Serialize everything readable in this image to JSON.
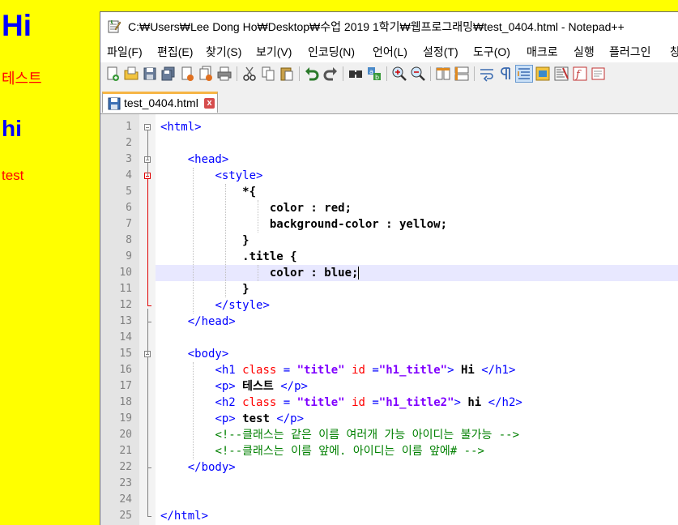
{
  "rendered_page": {
    "h1": "Hi",
    "p1": "테스트",
    "h2": "hi",
    "p2": "test"
  },
  "window": {
    "title": "C:₩Users₩Lee Dong Ho₩Desktop₩수업 2019 1학기₩웹프로그래밍₩test_0404.html - Notepad++",
    "menu": [
      "파일(F)",
      "편집(E)",
      "찾기(S)",
      "보기(V)",
      "인코딩(N)",
      "언어(L)",
      "설정(T)",
      "도구(O)",
      "매크로",
      "실행",
      "플러그인",
      "창"
    ],
    "tab": {
      "label": "test_0404.html",
      "close": "x"
    }
  },
  "editor": {
    "lines": [
      {
        "n": "1",
        "segs": [
          [
            "tag",
            "<html>"
          ]
        ]
      },
      {
        "n": "2",
        "segs": []
      },
      {
        "n": "3",
        "segs": [
          [
            "txt",
            "    "
          ],
          [
            "tag",
            "<head>"
          ]
        ]
      },
      {
        "n": "4",
        "segs": [
          [
            "txt",
            "        "
          ],
          [
            "tag",
            "<style>"
          ]
        ]
      },
      {
        "n": "5",
        "segs": [
          [
            "sel",
            "            *{"
          ]
        ]
      },
      {
        "n": "6",
        "segs": [
          [
            "sel",
            "                color : red;"
          ]
        ]
      },
      {
        "n": "7",
        "segs": [
          [
            "sel",
            "                background-color : yellow;"
          ]
        ]
      },
      {
        "n": "8",
        "segs": [
          [
            "sel",
            "            }"
          ]
        ]
      },
      {
        "n": "9",
        "segs": [
          [
            "sel",
            "            .title {"
          ]
        ]
      },
      {
        "n": "10",
        "segs": [
          [
            "sel",
            "                color : blue;"
          ]
        ]
      },
      {
        "n": "11",
        "segs": [
          [
            "sel",
            "            }"
          ]
        ]
      },
      {
        "n": "12",
        "segs": [
          [
            "txt",
            "        "
          ],
          [
            "tag",
            "</style>"
          ]
        ]
      },
      {
        "n": "13",
        "segs": [
          [
            "txt",
            "    "
          ],
          [
            "tag",
            "</head>"
          ]
        ]
      },
      {
        "n": "14",
        "segs": []
      },
      {
        "n": "15",
        "segs": [
          [
            "txt",
            "    "
          ],
          [
            "tag",
            "<body>"
          ]
        ]
      },
      {
        "n": "16",
        "segs": [
          [
            "txt",
            "        "
          ],
          [
            "tag",
            "<h1 "
          ],
          [
            "attr",
            "class"
          ],
          [
            "tag",
            " = "
          ],
          [
            "str",
            "\"title\""
          ],
          [
            "tag",
            " "
          ],
          [
            "attr",
            "id"
          ],
          [
            "tag",
            " ="
          ],
          [
            "str",
            "\"h1_title\""
          ],
          [
            "tag",
            ">"
          ],
          [
            "txt",
            " Hi "
          ],
          [
            "tag",
            "</h1>"
          ]
        ]
      },
      {
        "n": "17",
        "segs": [
          [
            "txt",
            "        "
          ],
          [
            "tag",
            "<p>"
          ],
          [
            "txt",
            " 테스트 "
          ],
          [
            "tag",
            "</p>"
          ]
        ]
      },
      {
        "n": "18",
        "segs": [
          [
            "txt",
            "        "
          ],
          [
            "tag",
            "<h2 "
          ],
          [
            "attr",
            "class"
          ],
          [
            "tag",
            " = "
          ],
          [
            "str",
            "\"title\""
          ],
          [
            "tag",
            " "
          ],
          [
            "attr",
            "id"
          ],
          [
            "tag",
            " ="
          ],
          [
            "str",
            "\"h1_title2\""
          ],
          [
            "tag",
            ">"
          ],
          [
            "txt",
            " hi "
          ],
          [
            "tag",
            "</h2>"
          ]
        ]
      },
      {
        "n": "19",
        "segs": [
          [
            "txt",
            "        "
          ],
          [
            "tag",
            "<p>"
          ],
          [
            "txt",
            " test "
          ],
          [
            "tag",
            "</p>"
          ]
        ]
      },
      {
        "n": "20",
        "segs": [
          [
            "txt",
            "        "
          ],
          [
            "cmt",
            "<!--클래스는 같은 이름 여러개 가능 아이디는 불가능 -->"
          ]
        ]
      },
      {
        "n": "21",
        "segs": [
          [
            "txt",
            "        "
          ],
          [
            "cmt",
            "<!--클래스는 이름 앞에. 아이디는 이름 앞에# -->"
          ]
        ]
      },
      {
        "n": "22",
        "segs": [
          [
            "txt",
            "    "
          ],
          [
            "tag",
            "</body>"
          ]
        ]
      },
      {
        "n": "23",
        "segs": []
      },
      {
        "n": "24",
        "segs": []
      },
      {
        "n": "25",
        "segs": [
          [
            "tag",
            "</html>"
          ]
        ]
      }
    ],
    "current_line": "10"
  },
  "colors": {
    "page_bg": "#ffff00",
    "page_text": "#ff0000",
    "title_text": "#0000ff",
    "tag": "#0000ff",
    "attr": "#ff0000",
    "string": "#8000ff",
    "comment": "#008000",
    "current_line_bg": "#e8e8ff",
    "tab_accent": "#f6b545"
  },
  "icons": [
    "notepad-icon",
    "new-file-icon",
    "open-file-icon",
    "save-icon",
    "save-all-icon",
    "close-icon",
    "close-all-icon",
    "print-icon",
    "cut-icon",
    "copy-icon",
    "paste-icon",
    "undo-icon",
    "redo-icon",
    "find-icon",
    "replace-icon",
    "zoom-in-icon",
    "zoom-out-icon",
    "sync-vertical-icon",
    "sync-horizontal-icon",
    "word-wrap-icon",
    "show-all-chars-icon",
    "indent-guide-icon",
    "udl-icon",
    "doc-map-icon",
    "function-list-icon",
    "folder-workspace-icon"
  ]
}
